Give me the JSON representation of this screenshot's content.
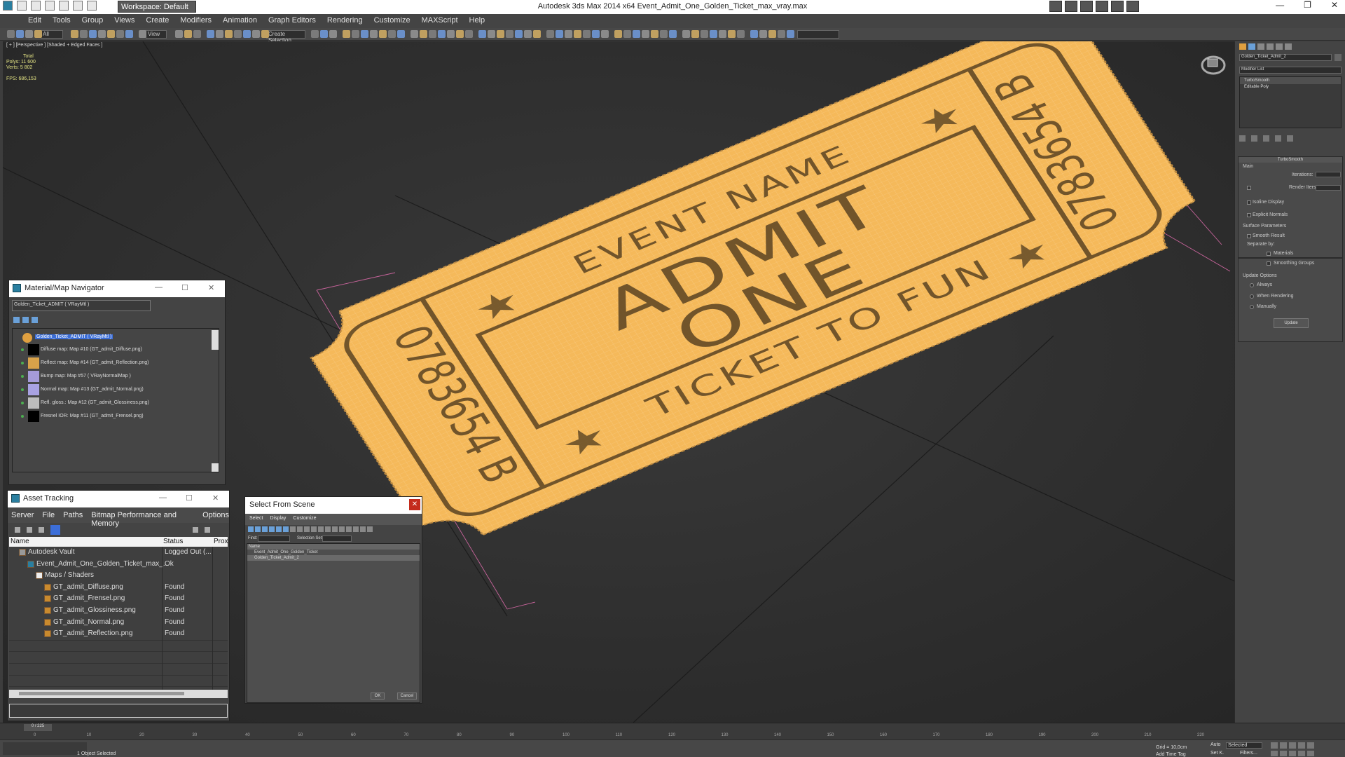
{
  "window": {
    "title": "Autodesk 3ds Max  2014 x64     Event_Admit_One_Golden_Ticket_max_vray.max",
    "workspace": "Workspace: Default"
  },
  "menu": [
    "Edit",
    "Tools",
    "Group",
    "Views",
    "Create",
    "Modifiers",
    "Animation",
    "Graph Editors",
    "Rendering",
    "Customize",
    "MAXScript",
    "Help"
  ],
  "toolbar": {
    "all_filter": "All",
    "view_dropdown": "View",
    "selection_set": "Create Selection"
  },
  "viewport": {
    "label": "[ + ] [Perspective ] [Shaded + Edged Faces ]",
    "stats": {
      "total_label": "Total",
      "polys_label": "Polys:",
      "polys": "11 600",
      "verts_label": "Verts:",
      "verts": "5 802",
      "fps_label": "FPS:",
      "fps": "686,153"
    },
    "ticket": {
      "line1": "EVENT NAME",
      "line2": "ADMIT",
      "line3": "ONE",
      "line4": "TICKET TO FUN",
      "serial": "0783654 B",
      "color": "#f5b95a",
      "ink": "#5a4322"
    }
  },
  "command_panel": {
    "object_name": "Golden_Ticket_Admit_2",
    "modifier_list": "Modifier List",
    "stack": [
      "TurboSmooth",
      "Editable Poly"
    ],
    "rollout": "TurboSmooth",
    "main": "Main",
    "iterations": "Iterations:",
    "render_iters": "Render Iters:",
    "isoline": "Isoline Display",
    "explicit": "Explicit Normals",
    "surface": "Surface Parameters",
    "smooth_result": "Smooth Result",
    "separate": "Separate by:",
    "materials": "Materials",
    "smoothing_groups": "Smoothing Groups",
    "update_options": "Update Options",
    "always": "Always",
    "when_rendering": "When Rendering",
    "manually": "Manually",
    "update_button": "Update"
  },
  "material_navigator": {
    "title": "Material/Map Navigator",
    "field": "Golden_Ticket_ADMIT ( VRayMtl )",
    "root": "Golden_Ticket_ADMIT ( VRayMtl )",
    "maps": [
      "Diffuse map: Map #10 (GT_admit_Diffuse.png)",
      "Reflect map: Map #14 (GT_admit_Reflection.png)",
      "Bump map: Map #57 ( VRayNormalMap )",
      "Normal map: Map #13 (GT_admit_Normal.png)",
      "Refl. gloss.: Map #12 (GT_admit_Glossiness.png)",
      "Fresnel IOR: Map #11 (GT_admit_Frensel.png)"
    ],
    "map_colors": [
      "#000000",
      "#d8a24a",
      "#a59bd8",
      "#a9a2e2",
      "#bdbdbd",
      "#000000"
    ]
  },
  "asset_tracking": {
    "title": "Asset Tracking",
    "menu": [
      "Server",
      "File",
      "Paths",
      "Bitmap Performance and Memory",
      "Options"
    ],
    "columns": [
      "Name",
      "Status",
      "Prox"
    ],
    "rows": [
      {
        "name": "Autodesk Vault",
        "status": "Logged Out (..."
      },
      {
        "name": "Event_Admit_One_Golden_Ticket_max_...",
        "status": "Ok"
      },
      {
        "name": "Maps / Shaders",
        "status": ""
      },
      {
        "name": "GT_admit_Diffuse.png",
        "status": "Found"
      },
      {
        "name": "GT_admit_Frensel.png",
        "status": "Found"
      },
      {
        "name": "GT_admit_Glossiness.png",
        "status": "Found"
      },
      {
        "name": "GT_admit_Normal.png",
        "status": "Found"
      },
      {
        "name": "GT_admit_Reflection.png",
        "status": "Found"
      }
    ]
  },
  "select_from_scene": {
    "title": "Select From Scene",
    "menu": [
      "Select",
      "Display",
      "Customize"
    ],
    "find_label": "Find:",
    "selection_set_label": "Selection Set:",
    "column": "Name",
    "items": [
      "Event_Admit_One_Golden_Ticket",
      "Golden_Ticket_Admit_2"
    ],
    "ok": "OK",
    "cancel": "Cancel"
  },
  "timeline": {
    "frame": "0 / 225",
    "ticks": [
      "0",
      "10",
      "20",
      "30",
      "40",
      "50",
      "60",
      "70",
      "80",
      "90",
      "100",
      "110",
      "120",
      "130",
      "140",
      "150",
      "160",
      "170",
      "180",
      "190",
      "200",
      "210",
      "220"
    ]
  },
  "status": {
    "selected": "1 Object Selected",
    "grid": "Grid = 10,0cm",
    "auto": "Auto",
    "selected_dd": "Selected",
    "set_k": "Set K.",
    "filters": "Filters...",
    "add_time_tag": "Add Time Tag"
  }
}
